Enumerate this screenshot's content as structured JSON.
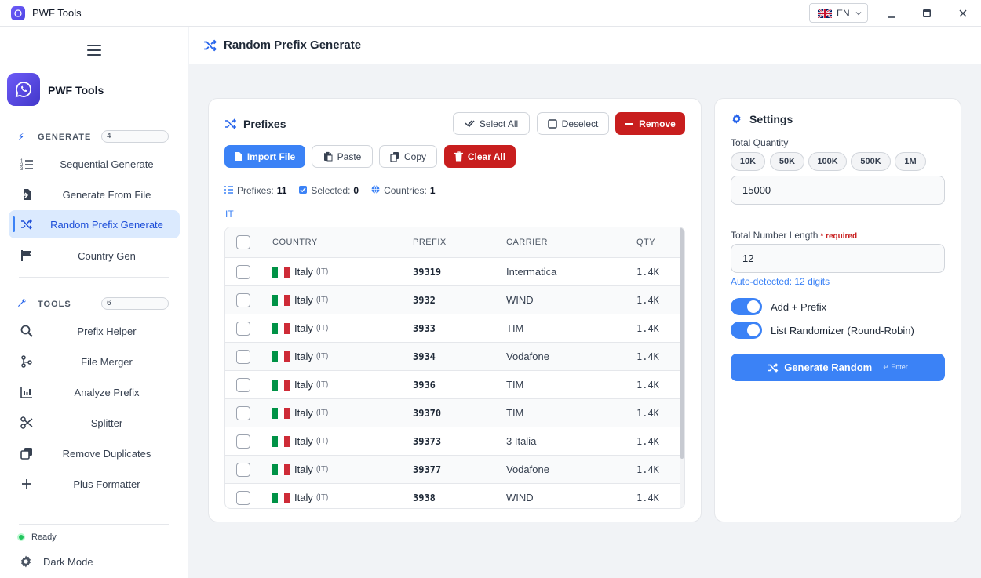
{
  "window": {
    "title": "PWF Tools",
    "language": "EN"
  },
  "sidebar": {
    "brand": "PWF Tools",
    "generate_section": {
      "label": "GENERATE",
      "count": "4"
    },
    "generate_items": [
      "Sequential Generate",
      "Generate From File",
      "Random Prefix Generate",
      "Country Gen"
    ],
    "tools_section": {
      "label": "TOOLS",
      "count": "6"
    },
    "tools_items": [
      "Prefix Helper",
      "File Merger",
      "Analyze Prefix",
      "Splitter",
      "Remove Duplicates",
      "Plus Formatter"
    ],
    "status": "Ready",
    "dark_mode": "Dark Mode"
  },
  "page": {
    "title": "Random Prefix Generate"
  },
  "prefixes": {
    "title": "Prefixes",
    "select_all": "Select All",
    "deselect": "Deselect",
    "remove": "Remove",
    "import_file": "Import File",
    "paste": "Paste",
    "copy": "Copy",
    "clear_all": "Clear All",
    "stats": {
      "prefixes_label": "Prefixes:",
      "prefixes_value": "11",
      "selected_label": "Selected:",
      "selected_value": "0",
      "countries_label": "Countries:",
      "countries_value": "1"
    },
    "filter_tag": "IT",
    "columns": [
      "COUNTRY",
      "PREFIX",
      "CARRIER",
      "QTY"
    ],
    "rows": [
      {
        "country": "Italy",
        "code": "(IT)",
        "prefix": "39319",
        "carrier": "Intermatica",
        "qty": "1.4K"
      },
      {
        "country": "Italy",
        "code": "(IT)",
        "prefix": "3932",
        "carrier": "WIND",
        "qty": "1.4K"
      },
      {
        "country": "Italy",
        "code": "(IT)",
        "prefix": "3933",
        "carrier": "TIM",
        "qty": "1.4K"
      },
      {
        "country": "Italy",
        "code": "(IT)",
        "prefix": "3934",
        "carrier": "Vodafone",
        "qty": "1.4K"
      },
      {
        "country": "Italy",
        "code": "(IT)",
        "prefix": "3936",
        "carrier": "TIM",
        "qty": "1.4K"
      },
      {
        "country": "Italy",
        "code": "(IT)",
        "prefix": "39370",
        "carrier": "TIM",
        "qty": "1.4K"
      },
      {
        "country": "Italy",
        "code": "(IT)",
        "prefix": "39373",
        "carrier": "3 Italia",
        "qty": "1.4K"
      },
      {
        "country": "Italy",
        "code": "(IT)",
        "prefix": "39377",
        "carrier": "Vodafone",
        "qty": "1.4K"
      },
      {
        "country": "Italy",
        "code": "(IT)",
        "prefix": "3938",
        "carrier": "WIND",
        "qty": "1.4K"
      }
    ]
  },
  "settings": {
    "title": "Settings",
    "total_quantity_label": "Total Quantity",
    "quantity_presets": [
      "10K",
      "50K",
      "100K",
      "500K",
      "1M"
    ],
    "total_quantity_value": "15000",
    "number_length_label": "Total Number Length",
    "required": "* required",
    "number_length_value": "12",
    "auto_detected": "Auto-detected: 12 digits",
    "add_prefix_label": "Add + Prefix",
    "add_prefix_on": true,
    "randomizer_label": "List Randomizer (Round-Robin)",
    "randomizer_on": true,
    "generate_button": "Generate Random",
    "generate_shortcut": "↵ Enter"
  },
  "colors": {
    "accent": "#3b82f6",
    "danger": "#c81e1e",
    "brand": "#4f46e5",
    "active_bg": "#dbeafe",
    "status_ok": "#22c55e"
  }
}
